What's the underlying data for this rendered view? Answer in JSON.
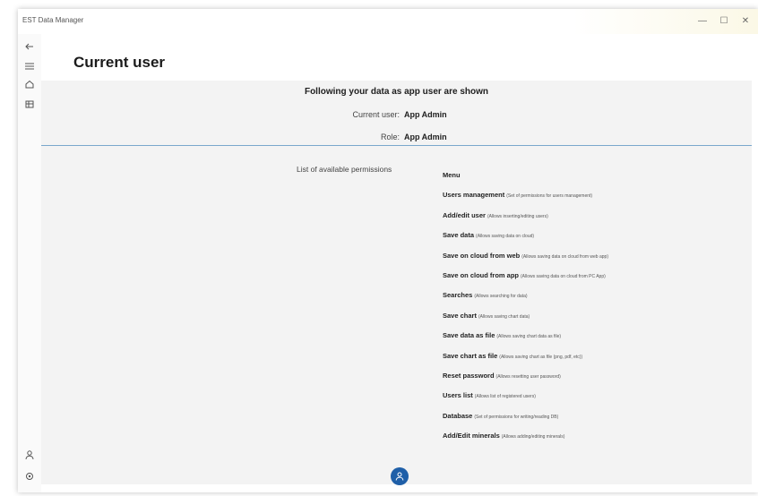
{
  "window": {
    "app_title": "EST Data Manager",
    "minimize_glyph": "—",
    "maximize_glyph": "☐",
    "close_glyph": "✕"
  },
  "rail": {
    "icons": [
      "back-arrow-icon",
      "hamburger-menu-icon",
      "home-icon",
      "database-icon",
      "user-icon",
      "settings-icon"
    ]
  },
  "page": {
    "title": "Current user"
  },
  "header": {
    "heading": "Following your data as app user are shown",
    "current_user_label": "Current user:",
    "current_user_value": "App Admin",
    "role_label": "Role:",
    "role_value": "App Admin"
  },
  "permissions": {
    "title": "List of available permissions",
    "items": [
      {
        "name": "Menu",
        "desc": ""
      },
      {
        "name": "Users management",
        "desc": "(Set of permissions for users management)"
      },
      {
        "name": "Add/edit user",
        "desc": "(Allows inserting/editing users)"
      },
      {
        "name": "Save data",
        "desc": "(Allows saving data on cloud)"
      },
      {
        "name": "Save on cloud from web",
        "desc": "(Allows saving data on cloud from web app)"
      },
      {
        "name": "Save on cloud from app",
        "desc": "(Allows saving data on cloud from PC App)"
      },
      {
        "name": "Searches",
        "desc": "(Allows searching for data)"
      },
      {
        "name": "Save chart",
        "desc": "(Allows saving chart data)"
      },
      {
        "name": "Save data as file",
        "desc": "(Allows saving chart data as file)"
      },
      {
        "name": "Save chart as file",
        "desc": "(Allows saving chart as file (png, pdf, etc))"
      },
      {
        "name": "Reset password",
        "desc": "(Allows resetting user password)"
      },
      {
        "name": "Users list",
        "desc": "(Allows list of registered users)"
      },
      {
        "name": "Database",
        "desc": "(Set of permissions for writing/reading DB)"
      },
      {
        "name": "Add/Edit minerals",
        "desc": "(Allows adding/editing minerals)"
      }
    ]
  },
  "colors": {
    "accent": "#1f5fa8",
    "divider": "#7aa7cc",
    "card_background": "#f3f3f3"
  },
  "fab": {
    "icon": "users-icon"
  }
}
